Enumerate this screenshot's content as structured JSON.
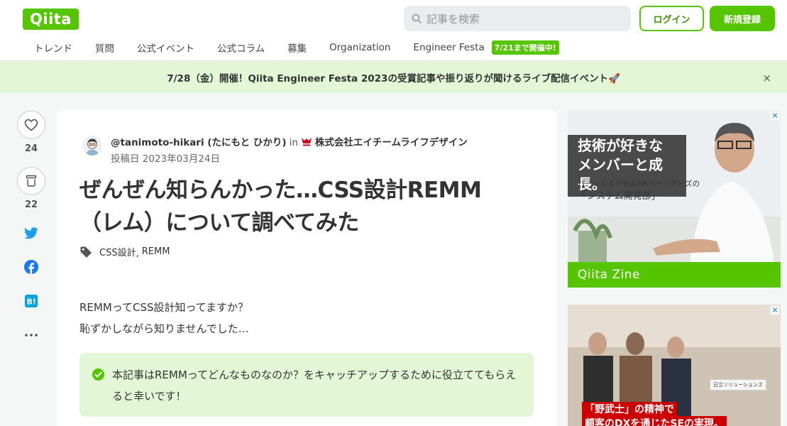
{
  "header": {
    "logo": "Qiita",
    "search_placeholder": "記事を検索",
    "login_label": "ログイン",
    "signup_label": "新規登録"
  },
  "nav": {
    "items": [
      "トレンド",
      "質問",
      "公式イベント",
      "公式コラム",
      "募集",
      "Organization",
      "Engineer Festa"
    ],
    "festa_badge": "7/21まで開催中!"
  },
  "banner": {
    "text": "7/28（金）開催！Qiita Engineer Festa 2023の受賞記事や振り返りが聞けるライブ配信イベント🚀",
    "close": "×"
  },
  "actions": {
    "likes": "24",
    "stocks": "22"
  },
  "article": {
    "author": "@tanimoto-hikari (たにもと ひかり)",
    "in_word": "in",
    "organization": "株式会社エイチームライフデザイン",
    "posted": "投稿日 2023年03月24日",
    "title": "ぜんぜん知らんかった…CSS設計REMM（レム）について調べてみた",
    "tags": [
      "CSS設計",
      "REMM"
    ],
    "body_lines": [
      "REMMってCSS設計知ってますか？",
      "恥ずかしながら知りませんでした…"
    ],
    "note": "本記事はREMMってどんなものなのか？をキャッチアップするために役立ててもらえると幸いです！"
  },
  "ads": {
    "ad1": {
      "headline_1": "技術が好きな",
      "headline_2": "メンバーと成長。",
      "sub_1": "パーソルエクセルHRパートナーズの",
      "sub_2": "「システム開発部」",
      "footer": "Qiita Zine",
      "close": "✕"
    },
    "ad2": {
      "tag": "日立ソリューションズ",
      "line_1": "「野武士」の精神で",
      "line_2": "顧客のDXを通じたSEの実現。",
      "close": "✕"
    }
  },
  "colors": {
    "brand": "#55c500",
    "banner_bg": "#e3f6d6"
  }
}
